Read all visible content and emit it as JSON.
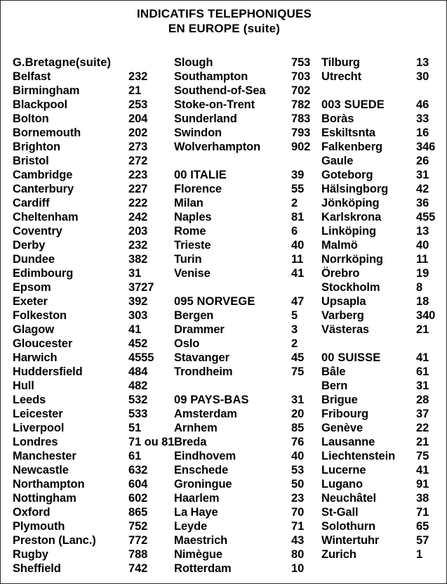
{
  "document": {
    "title_line_1": "INDICATIFS TELEPHONIQUES",
    "title_line_2": "EN EUROPE (suite)",
    "text_color": "#000000",
    "background_color": "#ffffff",
    "border_color": "#2b2b2b"
  },
  "columns": [
    {
      "id": "column-1",
      "rows": [
        {
          "name": "G.Bretagne(suite)",
          "value": "",
          "kind": "heading"
        },
        {
          "name": "Belfast",
          "value": "232",
          "kind": "entry"
        },
        {
          "name": "Birmingham",
          "value": "21",
          "kind": "entry"
        },
        {
          "name": "Blackpool",
          "value": "253",
          "kind": "entry"
        },
        {
          "name": "Bolton",
          "value": "204",
          "kind": "entry"
        },
        {
          "name": "Bornemouth",
          "value": "202",
          "kind": "entry"
        },
        {
          "name": "Brighton",
          "value": "273",
          "kind": "entry"
        },
        {
          "name": "Bristol",
          "value": "272",
          "kind": "entry"
        },
        {
          "name": "Cambridge",
          "value": "223",
          "kind": "entry"
        },
        {
          "name": "Canterbury",
          "value": "227",
          "kind": "entry"
        },
        {
          "name": "Cardiff",
          "value": "222",
          "kind": "entry"
        },
        {
          "name": "Cheltenham",
          "value": "242",
          "kind": "entry"
        },
        {
          "name": "Coventry",
          "value": "203",
          "kind": "entry"
        },
        {
          "name": "Derby",
          "value": "232",
          "kind": "entry"
        },
        {
          "name": "Dundee",
          "value": "382",
          "kind": "entry"
        },
        {
          "name": "Edimbourg",
          "value": "31",
          "kind": "entry"
        },
        {
          "name": "Epsom",
          "value": "3727",
          "kind": "entry"
        },
        {
          "name": "Exeter",
          "value": "392",
          "kind": "entry"
        },
        {
          "name": "Folkeston",
          "value": "303",
          "kind": "entry"
        },
        {
          "name": "Glagow",
          "value": "41",
          "kind": "entry"
        },
        {
          "name": "Gloucester",
          "value": "452",
          "kind": "entry"
        },
        {
          "name": "Harwich",
          "value": "4555",
          "kind": "entry"
        },
        {
          "name": "Huddersfield",
          "value": "484",
          "kind": "entry"
        },
        {
          "name": "Hull",
          "value": "482",
          "kind": "entry"
        },
        {
          "name": "Leeds",
          "value": "532",
          "kind": "entry"
        },
        {
          "name": "Leicester",
          "value": "533",
          "kind": "entry"
        },
        {
          "name": "Liverpool",
          "value": "51",
          "kind": "entry"
        },
        {
          "name": "Londres",
          "value": "71 ou 81",
          "kind": "entry"
        },
        {
          "name": "Manchester",
          "value": "61",
          "kind": "entry"
        },
        {
          "name": "Newcastle",
          "value": "632",
          "kind": "entry"
        },
        {
          "name": "Northampton",
          "value": "604",
          "kind": "entry"
        },
        {
          "name": "Nottingham",
          "value": "602",
          "kind": "entry"
        },
        {
          "name": "Oxford",
          "value": "865",
          "kind": "entry"
        },
        {
          "name": "Plymouth",
          "value": "752",
          "kind": "entry"
        },
        {
          "name": "Preston (Lanc.)",
          "value": "772",
          "kind": "entry"
        },
        {
          "name": "Rugby",
          "value": "788",
          "kind": "entry"
        },
        {
          "name": "Sheffield",
          "value": "742",
          "kind": "entry"
        }
      ]
    },
    {
      "id": "column-2",
      "rows": [
        {
          "name": "Slough",
          "value": "753",
          "kind": "entry"
        },
        {
          "name": "Southampton",
          "value": "703",
          "kind": "entry"
        },
        {
          "name": "Southend-of-Sea",
          "value": "702",
          "kind": "entry"
        },
        {
          "name": "Stoke-on-Trent",
          "value": "782",
          "kind": "entry"
        },
        {
          "name": "Sunderland",
          "value": "783",
          "kind": "entry"
        },
        {
          "name": "Swindon",
          "value": "793",
          "kind": "entry"
        },
        {
          "name": "Wolverhampton",
          "value": "902",
          "kind": "entry"
        },
        {
          "name": "",
          "value": "",
          "kind": "spacer"
        },
        {
          "name": "00 ITALIE",
          "value": "39",
          "kind": "heading"
        },
        {
          "name": "Florence",
          "value": "55",
          "kind": "entry"
        },
        {
          "name": "Milan",
          "value": "2",
          "kind": "entry"
        },
        {
          "name": "Naples",
          "value": "81",
          "kind": "entry"
        },
        {
          "name": "Rome",
          "value": "6",
          "kind": "entry"
        },
        {
          "name": "Trieste",
          "value": "40",
          "kind": "entry"
        },
        {
          "name": "Turin",
          "value": "11",
          "kind": "entry"
        },
        {
          "name": "Venise",
          "value": "41",
          "kind": "entry"
        },
        {
          "name": "",
          "value": "",
          "kind": "spacer"
        },
        {
          "name": "095 NORVEGE",
          "value": "47",
          "kind": "heading"
        },
        {
          "name": "Bergen",
          "value": "5",
          "kind": "entry"
        },
        {
          "name": "Drammer",
          "value": "3",
          "kind": "entry"
        },
        {
          "name": "Oslo",
          "value": "2",
          "kind": "entry"
        },
        {
          "name": "Stavanger",
          "value": "45",
          "kind": "entry"
        },
        {
          "name": "Trondheim",
          "value": "75",
          "kind": "entry"
        },
        {
          "name": "",
          "value": "",
          "kind": "spacer"
        },
        {
          "name": "09 PAYS-BAS",
          "value": "31",
          "kind": "heading"
        },
        {
          "name": "Amsterdam",
          "value": "20",
          "kind": "entry"
        },
        {
          "name": "Arnhem",
          "value": "85",
          "kind": "entry"
        },
        {
          "name": "Breda",
          "value": "76",
          "kind": "entry"
        },
        {
          "name": "Eindhovem",
          "value": "40",
          "kind": "entry"
        },
        {
          "name": "Enschede",
          "value": "53",
          "kind": "entry"
        },
        {
          "name": "Groningue",
          "value": "50",
          "kind": "entry"
        },
        {
          "name": "Haarlem",
          "value": "23",
          "kind": "entry"
        },
        {
          "name": "La Haye",
          "value": "70",
          "kind": "entry"
        },
        {
          "name": "Leyde",
          "value": "71",
          "kind": "entry"
        },
        {
          "name": "Maestrich",
          "value": "43",
          "kind": "entry"
        },
        {
          "name": "Nimègue",
          "value": "80",
          "kind": "entry"
        },
        {
          "name": "Rotterdam",
          "value": "10",
          "kind": "entry"
        }
      ]
    },
    {
      "id": "column-3",
      "rows": [
        {
          "name": "Tilburg",
          "value": "13",
          "kind": "entry"
        },
        {
          "name": "Utrecht",
          "value": "30",
          "kind": "entry"
        },
        {
          "name": "",
          "value": "",
          "kind": "spacer"
        },
        {
          "name": "003 SUEDE",
          "value": "46",
          "kind": "heading"
        },
        {
          "name": "Boràs",
          "value": "33",
          "kind": "entry"
        },
        {
          "name": "Eskiltsnta",
          "value": "16",
          "kind": "entry"
        },
        {
          "name": "Falkenberg",
          "value": "346",
          "kind": "entry"
        },
        {
          "name": "Gaule",
          "value": "26",
          "kind": "entry"
        },
        {
          "name": "Goteborg",
          "value": "31",
          "kind": "entry"
        },
        {
          "name": "Hälsingborg",
          "value": "42",
          "kind": "entry"
        },
        {
          "name": "Jönköping",
          "value": "36",
          "kind": "entry"
        },
        {
          "name": "Karlskrona",
          "value": "455",
          "kind": "entry"
        },
        {
          "name": "Linköping",
          "value": "13",
          "kind": "entry"
        },
        {
          "name": "Malmö",
          "value": "40",
          "kind": "entry"
        },
        {
          "name": "Norrköping",
          "value": "11",
          "kind": "entry"
        },
        {
          "name": "Örebro",
          "value": "19",
          "kind": "entry"
        },
        {
          "name": "Stockholm",
          "value": "8",
          "kind": "entry"
        },
        {
          "name": "Upsapla",
          "value": "18",
          "kind": "entry"
        },
        {
          "name": "Varberg",
          "value": "340",
          "kind": "entry"
        },
        {
          "name": "Västeras",
          "value": "21",
          "kind": "entry"
        },
        {
          "name": "",
          "value": "",
          "kind": "spacer"
        },
        {
          "name": "00 SUISSE",
          "value": "41",
          "kind": "heading"
        },
        {
          "name": "Bâle",
          "value": "61",
          "kind": "entry"
        },
        {
          "name": "Bern",
          "value": "31",
          "kind": "entry"
        },
        {
          "name": "Brigue",
          "value": "28",
          "kind": "entry"
        },
        {
          "name": "Fribourg",
          "value": "37",
          "kind": "entry"
        },
        {
          "name": "Genève",
          "value": "22",
          "kind": "entry"
        },
        {
          "name": "Lausanne",
          "value": "21",
          "kind": "entry"
        },
        {
          "name": "Liechtenstein",
          "value": "75",
          "kind": "entry"
        },
        {
          "name": "Lucerne",
          "value": "41",
          "kind": "entry"
        },
        {
          "name": "Lugano",
          "value": "91",
          "kind": "entry"
        },
        {
          "name": "Neuchâtel",
          "value": "38",
          "kind": "entry"
        },
        {
          "name": "St-Gall",
          "value": "71",
          "kind": "entry"
        },
        {
          "name": "Solothurn",
          "value": "65",
          "kind": "entry"
        },
        {
          "name": "Wintertuhr",
          "value": "57",
          "kind": "entry"
        },
        {
          "name": "Zurich",
          "value": "1",
          "kind": "entry"
        }
      ]
    }
  ]
}
